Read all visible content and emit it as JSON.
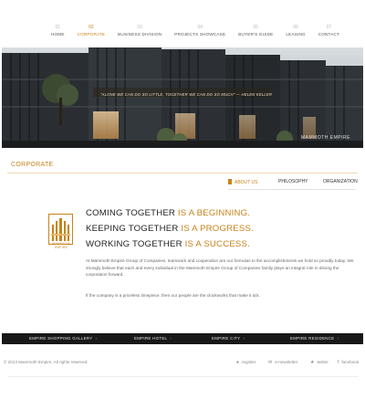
{
  "nav": {
    "items": [
      {
        "num": "01",
        "label": "HOME"
      },
      {
        "num": "02",
        "label": "CORPORATE"
      },
      {
        "num": "03",
        "label": "BUSINESS DIVISION"
      },
      {
        "num": "04",
        "label": "PROJECTS SHOWCASE"
      },
      {
        "num": "05",
        "label": "BUYER'S GUIDE"
      },
      {
        "num": "06",
        "label": "LEASING"
      },
      {
        "num": "07",
        "label": "CONTACT"
      }
    ],
    "active_index": 1
  },
  "hero": {
    "quote": "\"ALONE WE CAN DO SO LITTLE, TOGETHER WE CAN DO SO MUCH\" — HELEN KELLER",
    "brand": "MAMMOTH EMPIRE"
  },
  "section": {
    "title": "CORPORATE"
  },
  "subnav": {
    "about": "ABOUT US",
    "philosophy": "PHILOSOPHY",
    "organization": "ORGANIZATION"
  },
  "logo": {
    "line1": "MAMMOTH",
    "line2": "EMPIRE"
  },
  "headlines": {
    "h1_main": "COMING TOGETHER",
    "h1_tail": " IS A BEGINNING.",
    "h2_main": "KEEPING TOGETHER",
    "h2_tail": " IS A PROGRESS.",
    "h3_main": "WORKING TOGETHER",
    "h3_tail": " IS A SUCCESS."
  },
  "body": {
    "p1": "At Mammoth Empire Group of Companies, teamwork and cooperation are our formulas to the accomplishments we hold so proudly today. We strongly believe that each and every individual in the Mammoth Empire Group of Companies family plays an integral role in driving the corporation forward.",
    "p2": "If the company is a priceless timepiece, then our people are the clockworks that make it tick."
  },
  "footer": {
    "links": [
      "EMPIRE SHOPPING GALLERY",
      "EMPIRE HOTEL",
      "EMPIRE CITY",
      "EMPIRE RESIDENCE"
    ],
    "copyright": "© 2013 Mammoth Empire. All rights reserved.",
    "register": "register",
    "enewsletter": "e-newsletter",
    "twitter": "twitter",
    "facebook": "facebook"
  },
  "colors": {
    "accent": "#c8821a",
    "footbar": "#181818"
  }
}
